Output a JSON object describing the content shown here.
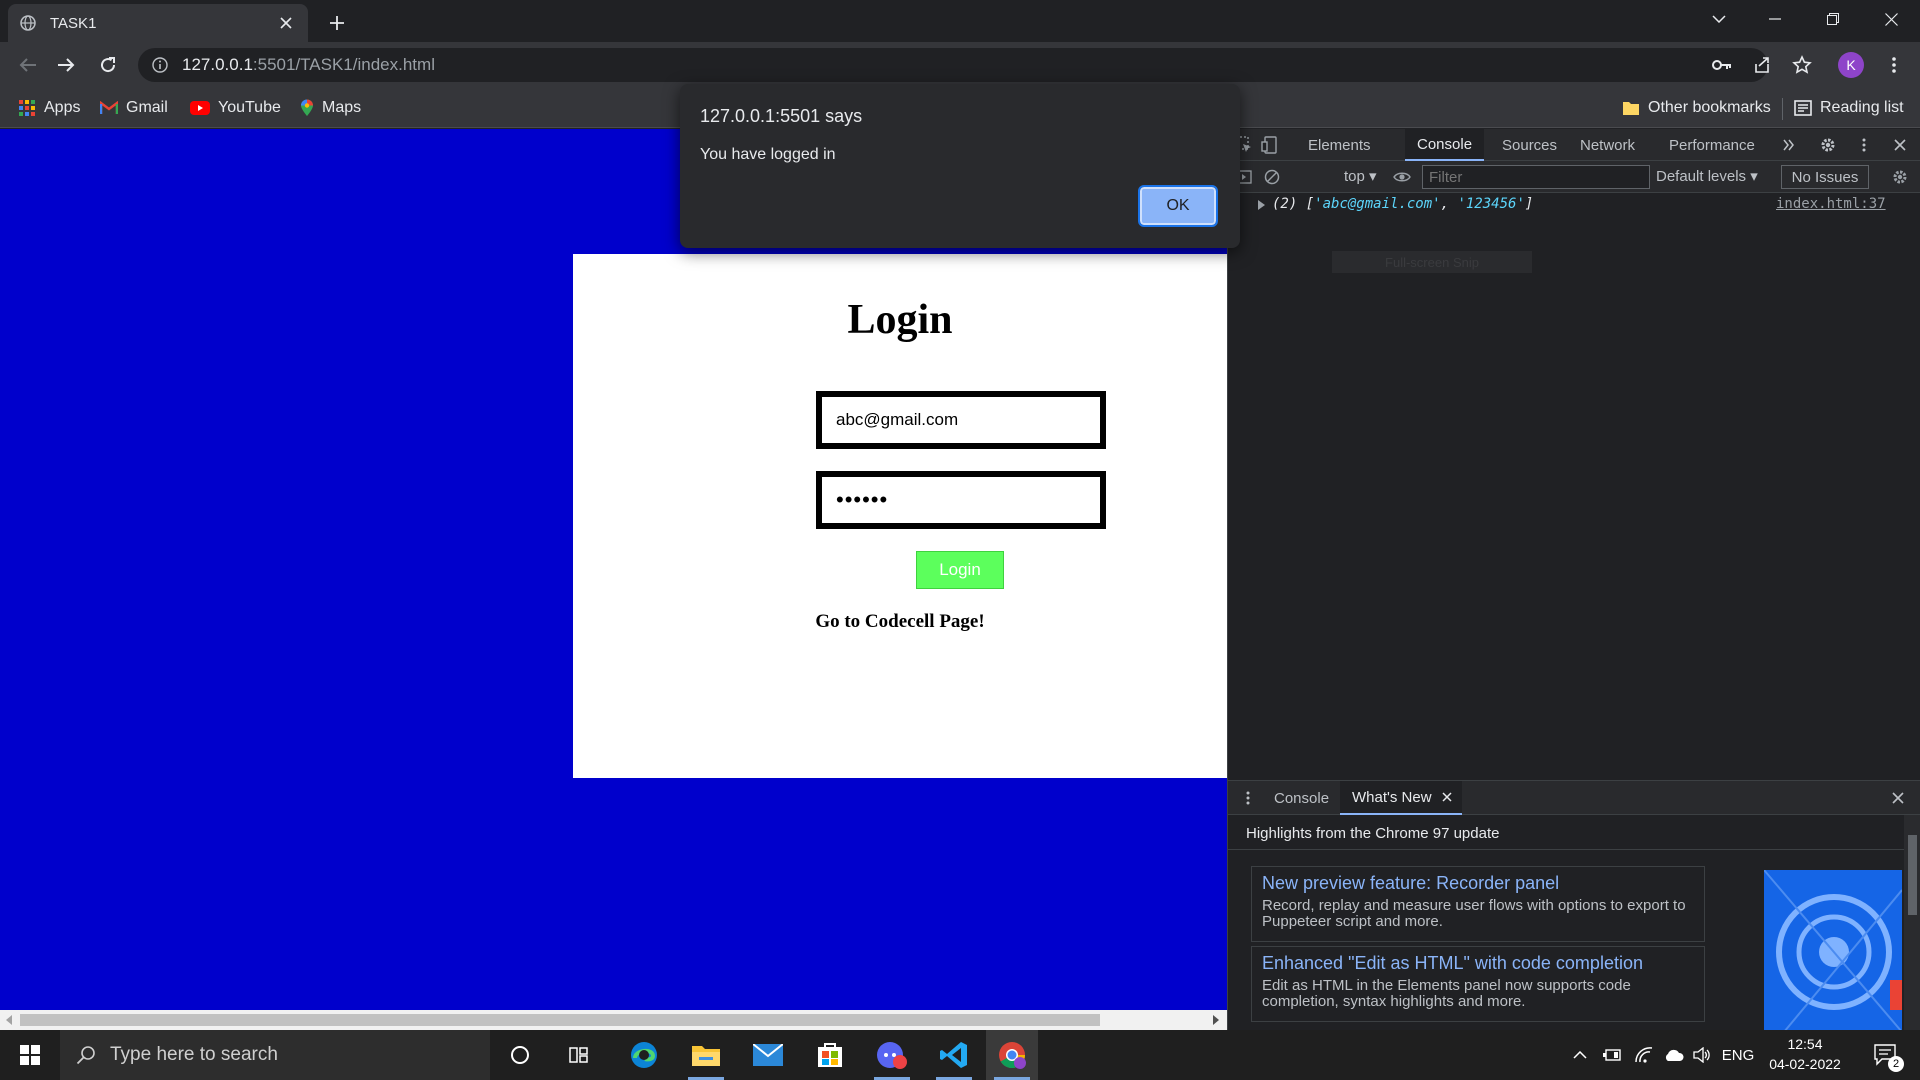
{
  "browser": {
    "tab_title": "TASK1",
    "url_host": "127.0.0.1",
    "url_path": ":5501/TASK1/index.html",
    "profile_initial": "K",
    "bookmarks": [
      "Apps",
      "Gmail",
      "YouTube",
      "Maps"
    ],
    "other_bookmarks": "Other bookmarks",
    "reading_list": "Reading list"
  },
  "alert": {
    "origin": "127.0.0.1:5501 says",
    "message": "You have logged in",
    "ok_label": "OK"
  },
  "page": {
    "title": "Login",
    "email_value": "abc@gmail.com",
    "password_value": "••••••",
    "login_label": "Login",
    "link_text": "Go to Codecell Page!"
  },
  "devtools": {
    "tabs": [
      "Elements",
      "Console",
      "Sources",
      "Network",
      "Performance"
    ],
    "active_tab": "Console",
    "context": "top",
    "filter_placeholder": "Filter",
    "levels": "Default levels",
    "issues": "No Issues",
    "log": {
      "prefix": "(2) [",
      "item1": "'abc@gmail.com'",
      "sep": ", ",
      "item2": "'123456'",
      "suffix": "]",
      "source": "index.html:37"
    },
    "ghost_text": "Full-screen Snip",
    "drawer_tabs": [
      "Console",
      "What's New"
    ],
    "drawer_active": "What's New",
    "whats_new_heading": "Highlights from the Chrome 97 update",
    "whats_new_items": [
      {
        "title": "New preview feature: Recorder panel",
        "desc": "Record, replay and measure user flows with options to export to Puppeteer script and more."
      },
      {
        "title": "Enhanced \"Edit as HTML\" with code completion",
        "desc": "Edit as HTML in the Elements panel now supports code completion, syntax highlights and more."
      }
    ]
  },
  "taskbar": {
    "search_placeholder": "Type here to search",
    "language": "ENG",
    "time": "12:54",
    "date": "04-02-2022",
    "notification_count": "2"
  },
  "colors": {
    "page_bg": "#0000cc",
    "login_button": "#5cff5c",
    "dialog_button": "#8ab4f8"
  }
}
